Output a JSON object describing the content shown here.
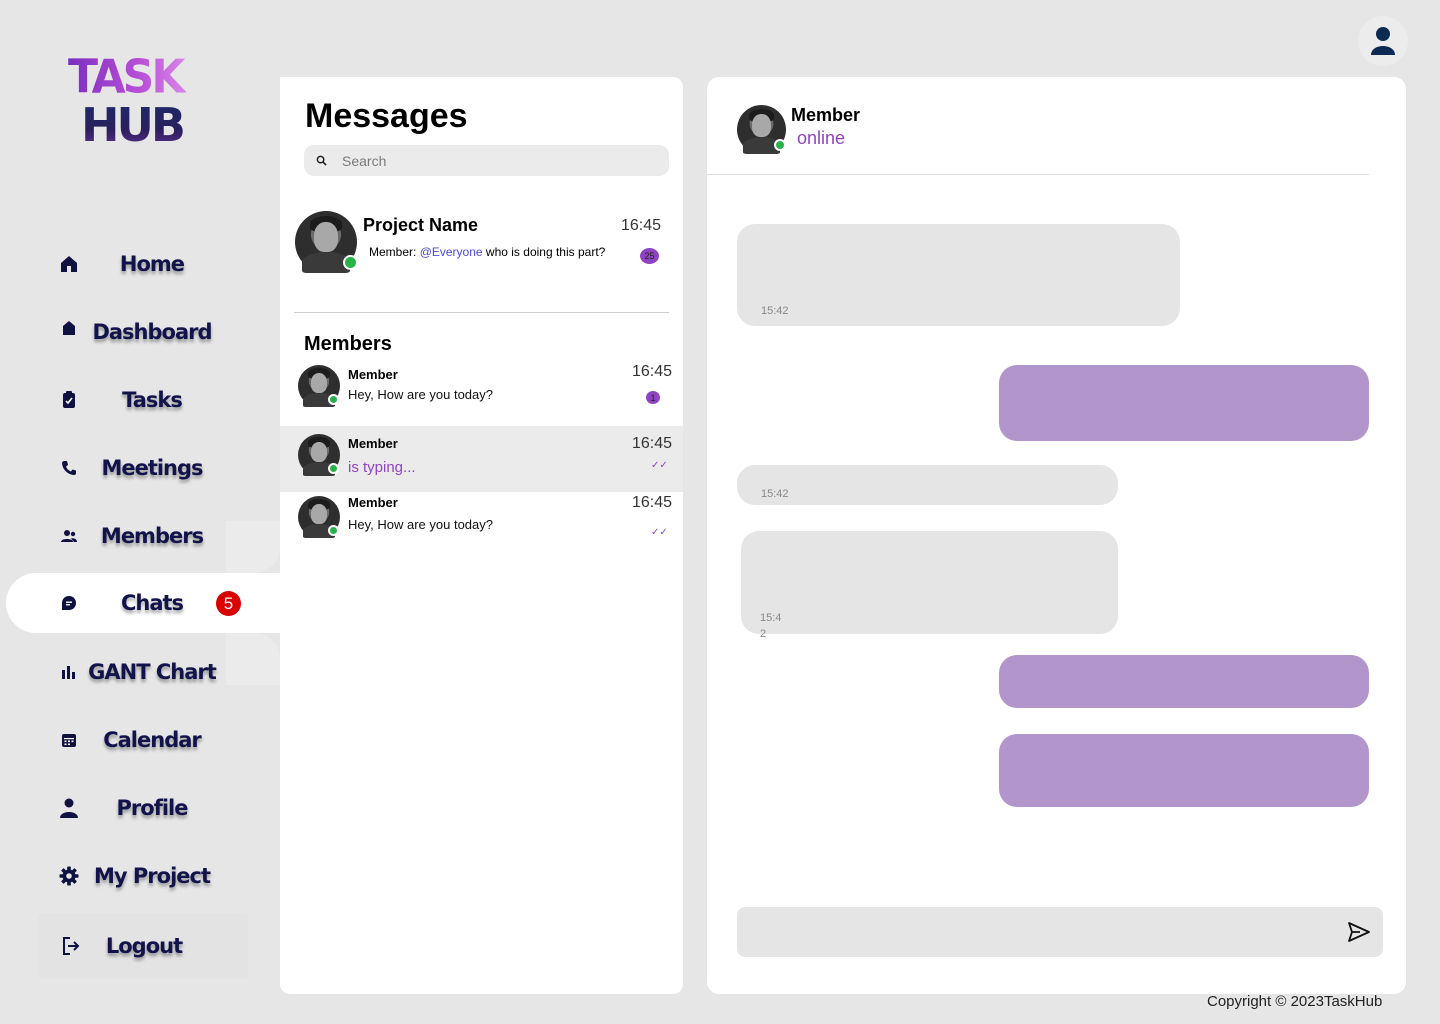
{
  "brand": {
    "line1": "TASK",
    "line2": "HUB"
  },
  "sidebar": {
    "items": [
      {
        "label": "Home",
        "icon": "home-icon"
      },
      {
        "label": "Dashboard",
        "icon": "dashboard-icon"
      },
      {
        "label": "Tasks",
        "icon": "clipboard-icon"
      },
      {
        "label": "Meetings",
        "icon": "phone-icon"
      },
      {
        "label": "Members",
        "icon": "people-icon"
      },
      {
        "label": "Chats",
        "icon": "chat-icon",
        "badge": "5",
        "active": true
      },
      {
        "label": "GANT Chart",
        "icon": "bar-chart-icon"
      },
      {
        "label": "Calendar",
        "icon": "calendar-icon"
      },
      {
        "label": "Profile",
        "icon": "person-icon"
      },
      {
        "label": "My Project",
        "icon": "gear-icon"
      },
      {
        "label": "Logout",
        "icon": "logout-icon"
      }
    ]
  },
  "messages": {
    "title": "Messages",
    "search": {
      "placeholder": "Search",
      "value": ""
    },
    "project": {
      "name": "Project Name",
      "time": "16:45",
      "sender": "Member",
      "mention": "@Everyone",
      "text": "who is doing this part?",
      "unread": "25"
    },
    "members_title": "Members",
    "members": [
      {
        "name": "Member",
        "text": "Hey, How are you today?",
        "time": "16:45",
        "unread": "1"
      },
      {
        "name": "Member",
        "text": "is typing...",
        "time": "16:45"
      },
      {
        "name": "Member",
        "text": "Hey, How are you today?",
        "time": "16:45"
      }
    ]
  },
  "chat": {
    "name": "Member",
    "status": "online",
    "bubbles": [
      {
        "time": "15:42"
      },
      {
        "time": "15:42"
      },
      {
        "time": "15:4\n2"
      }
    ],
    "composer": {
      "placeholder": "",
      "value": ""
    }
  },
  "footer": {
    "copyright": "Copyright © 2023TaskHub"
  },
  "colors": {
    "accent": "#8e44c2",
    "bubble_out": "#b295ca",
    "bubble_in": "#e5e5e5",
    "online": "#27b24a",
    "badge": "#d90000",
    "nav_text": "#12134a"
  }
}
